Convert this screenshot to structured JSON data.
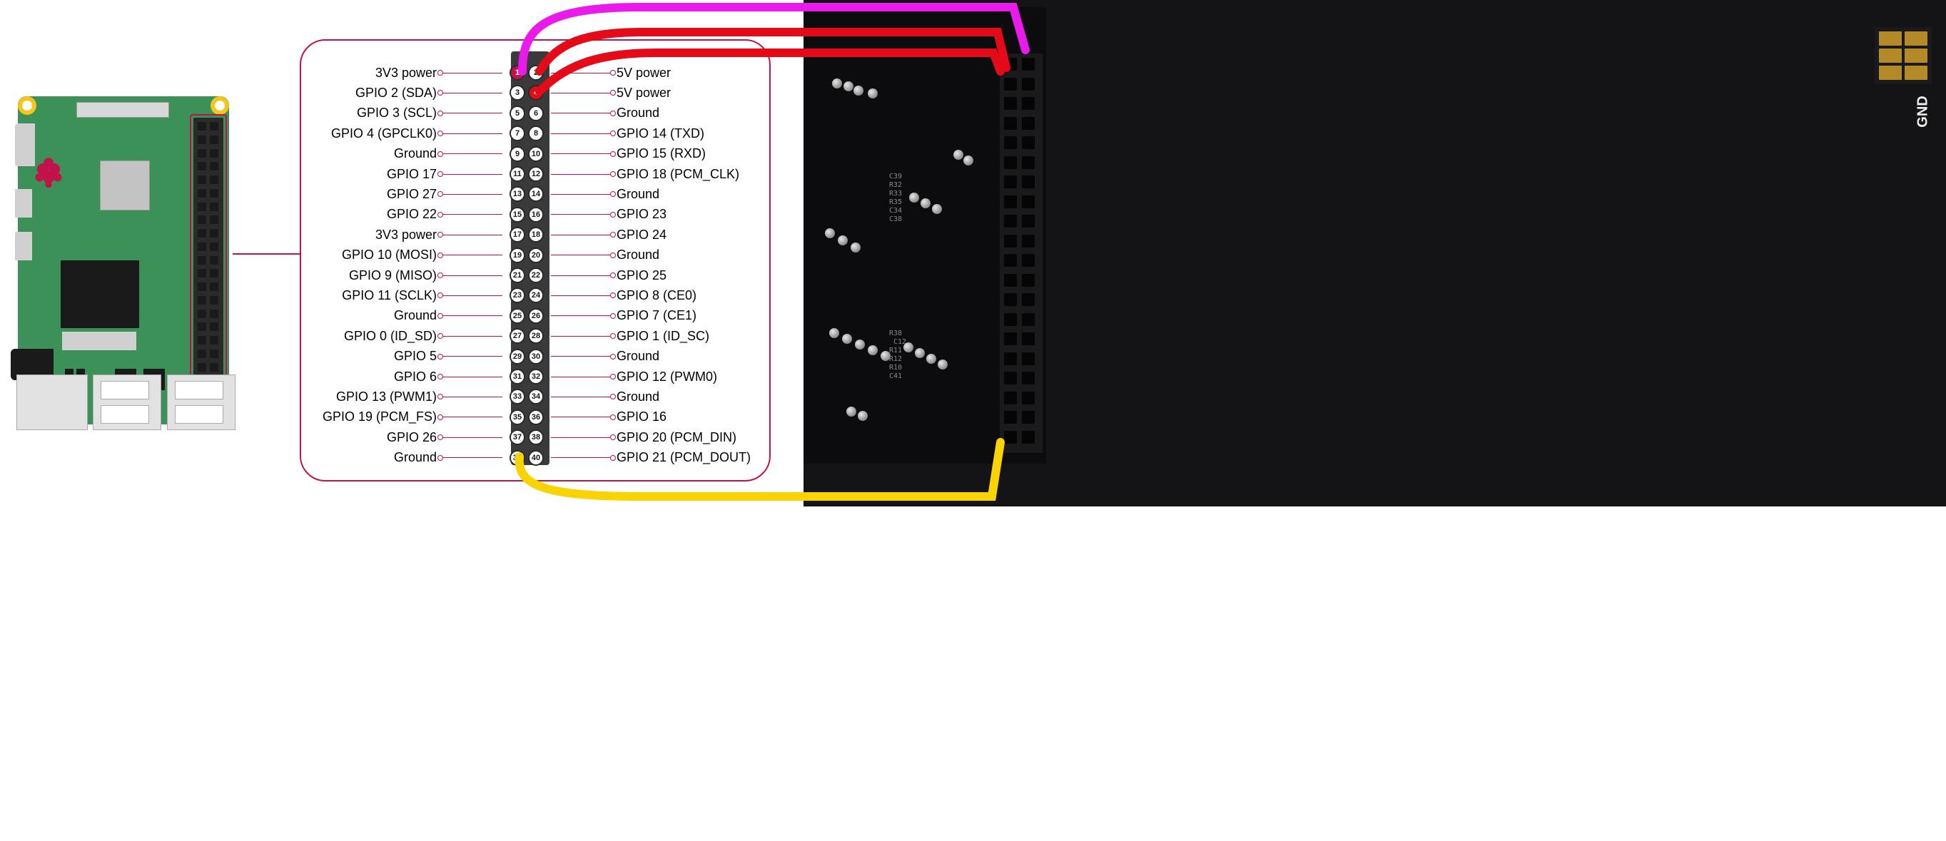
{
  "pinout": {
    "rows": [
      {
        "left": "3V3 power",
        "n1": 1,
        "n2": 2,
        "right": "5V power"
      },
      {
        "left": "GPIO 2 (SDA)",
        "n1": 3,
        "n2": 4,
        "right": "5V power"
      },
      {
        "left": "GPIO 3 (SCL)",
        "n1": 5,
        "n2": 6,
        "right": "Ground"
      },
      {
        "left": "GPIO 4 (GPCLK0)",
        "n1": 7,
        "n2": 8,
        "right": "GPIO 14 (TXD)"
      },
      {
        "left": "Ground",
        "n1": 9,
        "n2": 10,
        "right": "GPIO 15 (RXD)"
      },
      {
        "left": "GPIO 17",
        "n1": 11,
        "n2": 12,
        "right": "GPIO 18 (PCM_CLK)"
      },
      {
        "left": "GPIO 27",
        "n1": 13,
        "n2": 14,
        "right": "Ground"
      },
      {
        "left": "GPIO 22",
        "n1": 15,
        "n2": 16,
        "right": "GPIO 23"
      },
      {
        "left": "3V3 power",
        "n1": 17,
        "n2": 18,
        "right": "GPIO 24"
      },
      {
        "left": "GPIO 10 (MOSI)",
        "n1": 19,
        "n2": 20,
        "right": "Ground"
      },
      {
        "left": "GPIO 9 (MISO)",
        "n1": 21,
        "n2": 22,
        "right": "GPIO 25"
      },
      {
        "left": "GPIO 11 (SCLK)",
        "n1": 23,
        "n2": 24,
        "right": "GPIO 8 (CE0)"
      },
      {
        "left": "Ground",
        "n1": 25,
        "n2": 26,
        "right": "GPIO 7 (CE1)"
      },
      {
        "left": "GPIO 0 (ID_SD)",
        "n1": 27,
        "n2": 28,
        "right": "GPIO 1 (ID_SC)"
      },
      {
        "left": "GPIO 5",
        "n1": 29,
        "n2": 30,
        "right": "Ground"
      },
      {
        "left": "GPIO 6",
        "n1": 31,
        "n2": 32,
        "right": "GPIO 12 (PWM0)"
      },
      {
        "left": "GPIO 13 (PWM1)",
        "n1": 33,
        "n2": 34,
        "right": "Ground"
      },
      {
        "left": "GPIO 19 (PCM_FS)",
        "n1": 35,
        "n2": 36,
        "right": "GPIO 16"
      },
      {
        "left": "GPIO 26",
        "n1": 37,
        "n2": 38,
        "right": "GPIO 20 (PCM_DIN)"
      },
      {
        "left": "Ground",
        "n1": 39,
        "n2": 40,
        "right": "GPIO 21 (PCM_DOUT)"
      }
    ]
  },
  "photo": {
    "gnd_label": "GND",
    "refs": [
      "C39",
      "R32",
      "R33",
      "R35",
      "C34",
      "C38",
      "R38",
      "C12",
      "R11",
      "R12",
      "R10",
      "C41"
    ]
  },
  "wires": {
    "magenta": {
      "from_pin": 1,
      "to": "target-header-top-right"
    },
    "red1": {
      "from_pin": 2,
      "to": "target-header-row1-left"
    },
    "red2": {
      "from_pin": 4,
      "to": "target-header-row1-left"
    },
    "yellow": {
      "from_pin": 39,
      "to": "target-header-bottom-left"
    }
  },
  "colors": {
    "accent": "#c3124a",
    "pcb_green": "#3c9158",
    "wire_magenta": "#ea1aea",
    "wire_red": "#e40a18",
    "wire_yellow": "#f9d402"
  }
}
